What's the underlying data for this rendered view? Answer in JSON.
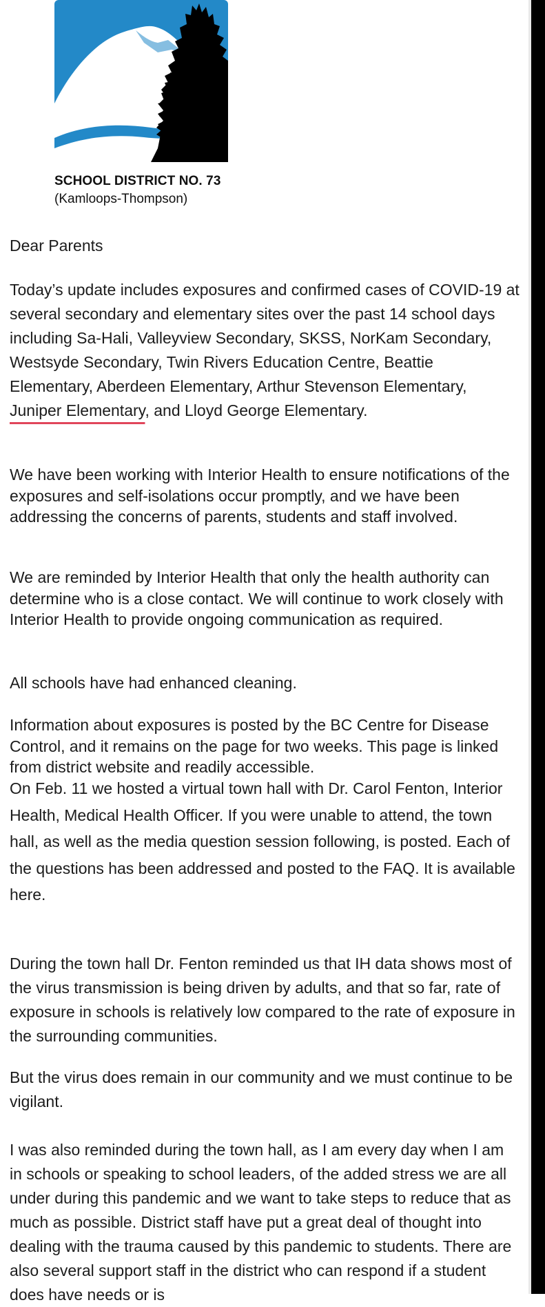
{
  "header": {
    "org_name": "SCHOOL DISTRICT NO. 73",
    "org_sub": "(Kamloops-Thompson)",
    "logo_icon": "mountain-trees-logo-icon"
  },
  "letter": {
    "greeting": "Dear Parents",
    "p1_before": "Today’s update includes exposures and confirmed cases of COVID-19 at several secondary and elementary sites over the past 14 school days including Sa-Hali, Valleyview Secondary, SKSS, NorKam Secondary, Westsyde Secondary, Twin Rivers Education Centre, Beattie Elementary, Aberdeen Elementary, Arthur Stevenson Elementary, ",
    "p1_underlined": "Juniper Elementary",
    "p1_after": ", and Lloyd George Elementary.",
    "p2": "We have been working with Interior Health to ensure notifications of the exposures and self-isolations occur promptly, and we have been addressing the concerns of parents, students and staff involved.",
    "p3": "We are reminded by Interior Health that only the health authority can determine who is a close contact. We will continue to work closely with Interior Health to provide ongoing communication as required.",
    "p4": "All schools have had enhanced cleaning.",
    "p5": "Information about exposures is posted by the BC Centre for Disease Control, and it remains on the page for two weeks. This page is linked from district website and readily accessible.",
    "p6": "On Feb. 11 we hosted a virtual town hall with Dr. Carol Fenton, Interior Health, Medical Health Officer. If you were unable to attend, the town hall, as well as the media question session following, is posted. Each of the questions has been addressed and posted to the FAQ. It is available here.",
    "p7": "During the town hall Dr. Fenton reminded us that IH data shows most of the virus transmission is being driven by adults, and that so far, rate of exposure in schools is relatively low compared to the rate of exposure in the surrounding communities.",
    "p8": "But the virus does remain in our community and we must continue to be vigilant.",
    "p9": "I was also reminded during the town hall, as I am every day when I am in schools or speaking to school leaders, of the added stress we are all under during this pandemic and we want to take steps to reduce that as much as possible. District staff have put a great deal of thought into dealing with the trauma caused by this pandemic to students. There are also several support staff in the district who can respond if a student does have needs or is"
  },
  "colors": {
    "logo_blue": "#2389c8",
    "underline": "#e0455a",
    "right_bar": "#000000"
  }
}
